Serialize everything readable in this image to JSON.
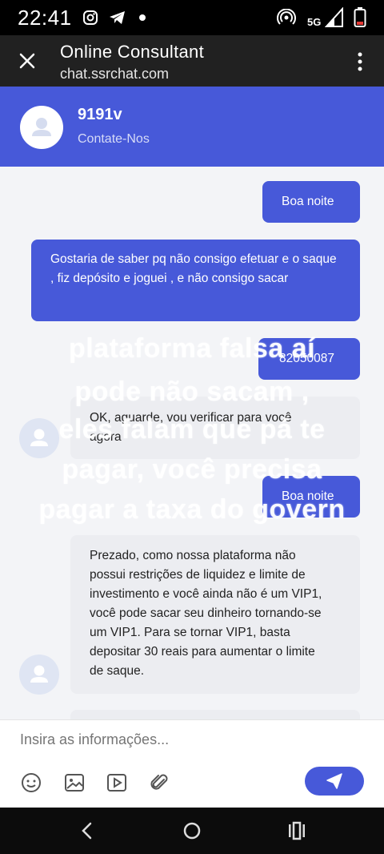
{
  "status_bar": {
    "time": "22:41",
    "network": "5G"
  },
  "app_bar": {
    "title": "Online Consultant",
    "url": "chat.ssrchat.com"
  },
  "chat_header": {
    "name": "9191v",
    "subtitle": "Contate-Nos"
  },
  "messages": [
    {
      "from": "user",
      "text": "Boa noite"
    },
    {
      "from": "user",
      "text": "Gostaria de saber pq não consigo efetuar e o saque , fiz depósito e  joguei , e não consigo sacar"
    },
    {
      "from": "user",
      "text": "82050087"
    },
    {
      "from": "agent",
      "text": "OK, aguarde, vou verificar para você agora"
    },
    {
      "from": "user",
      "text": "Boa noite"
    },
    {
      "from": "agent",
      "text": "Prezado, como nossa plataforma não possui restrições de liquidez e limite de investimento e você ainda não é um VIP1, você pode sacar seu dinheiro tornando-se um VIP1. Para se tornar VIP1, basta depositar 30 reais para aumentar o limite de saque."
    }
  ],
  "overlay_caption": [
    "plataforma falsa aí",
    "pode não sacam ,",
    "eles falam que pá te",
    "pagar, você precisa",
    "pagar a taxa do govern"
  ],
  "input": {
    "placeholder": "Insira as informações..."
  },
  "colors": {
    "accent": "#4759d9",
    "appbar": "#212121"
  }
}
